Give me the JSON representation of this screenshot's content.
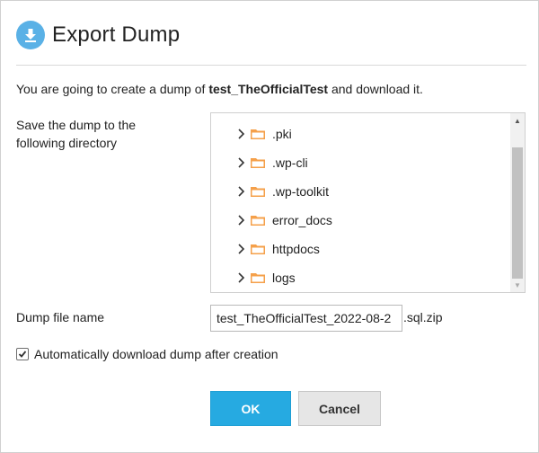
{
  "dialog": {
    "title": "Export Dump",
    "intro_prefix": "You are going to create a dump of ",
    "database_name": "test_TheOfficialTest",
    "intro_suffix": " and download it."
  },
  "directory": {
    "label": "Save the dump to the following directory",
    "items": [
      {
        "label": ".pki",
        "icon": "folder-icon"
      },
      {
        "label": ".wp-cli",
        "icon": "folder-icon"
      },
      {
        "label": ".wp-toolkit",
        "icon": "folder-icon"
      },
      {
        "label": "error_docs",
        "icon": "folder-icon"
      },
      {
        "label": "httpdocs",
        "icon": "folder-icon"
      },
      {
        "label": "logs",
        "icon": "folder-icon"
      }
    ]
  },
  "file": {
    "label": "Dump file name",
    "value": "test_TheOfficialTest_2022-08-2",
    "suffix": ".sql.zip"
  },
  "auto_download": {
    "label": "Automatically download dump after creation",
    "checked": true
  },
  "buttons": {
    "ok": "OK",
    "cancel": "Cancel"
  },
  "colors": {
    "primary": "#26aae1",
    "title_icon": "#5ab1e6",
    "folder": "#f5a04a"
  }
}
